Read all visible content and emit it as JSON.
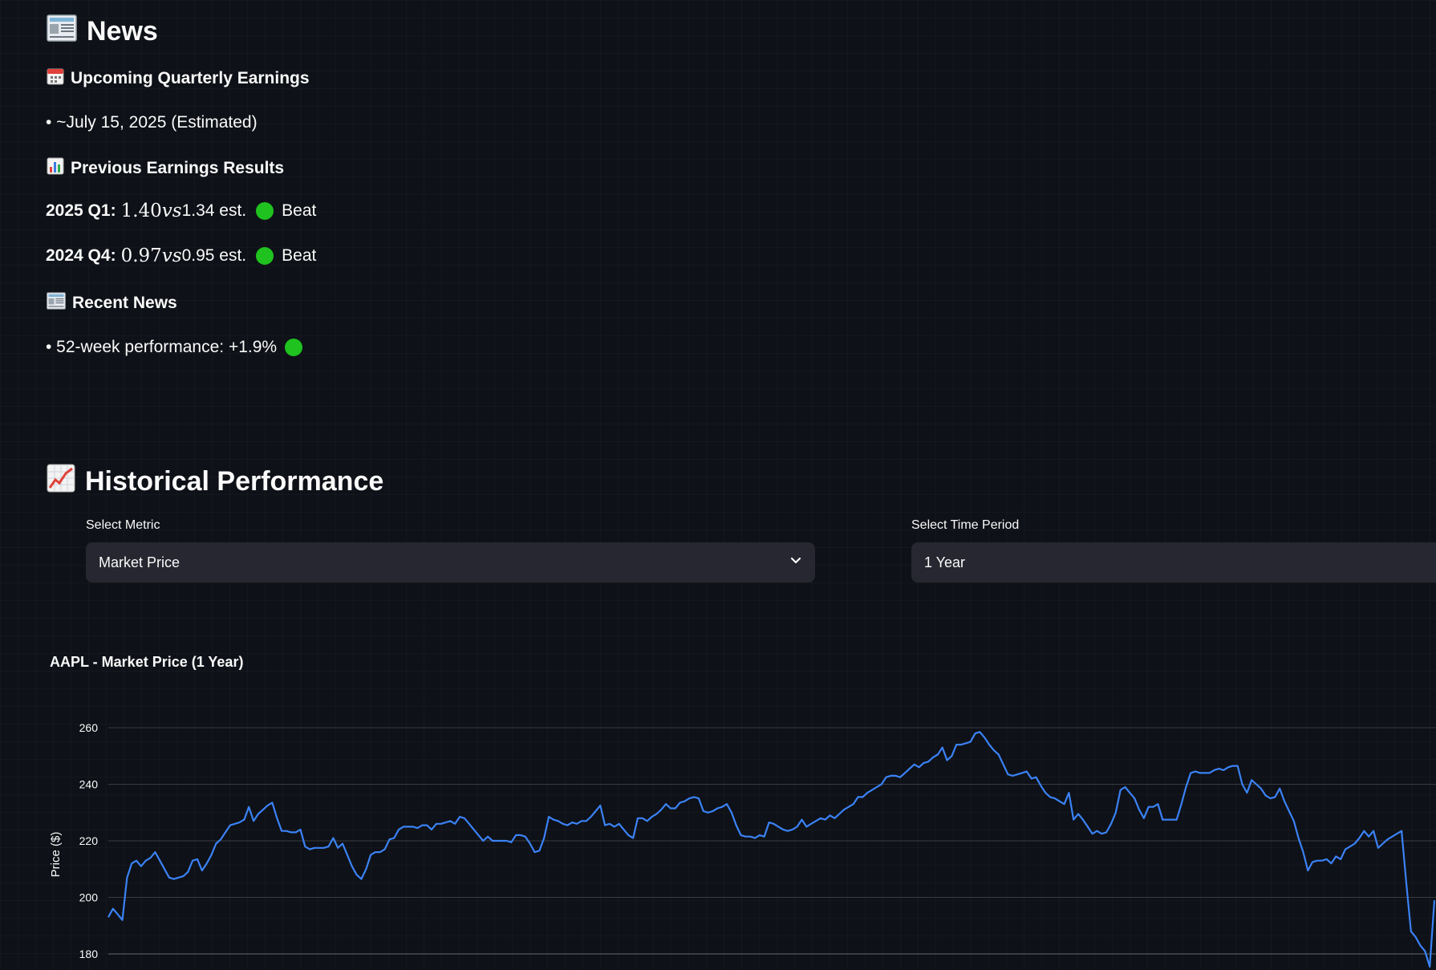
{
  "news": {
    "title": "News",
    "title_icon": "newspaper-icon",
    "upcoming": {
      "heading": "Upcoming Quarterly Earnings",
      "heading_icon": "calendar-icon",
      "item": "• ~July 15, 2025 (Estimated)"
    },
    "previous": {
      "heading": "Previous Earnings Results",
      "heading_icon": "bar-chart-icon",
      "results": [
        {
          "label": "2025 Q1:",
          "actual": "1.40",
          "vs": "vs",
          "est": "1.34 est.",
          "status": "Beat"
        },
        {
          "label": "2024 Q4:",
          "actual": "0.97",
          "vs": "vs",
          "est": "0.95 est.",
          "status": "Beat"
        }
      ]
    },
    "recent": {
      "heading": "Recent News",
      "heading_icon": "newspaper-icon",
      "item": "• 52-week performance: +1.9%"
    }
  },
  "historical": {
    "title": "Historical Performance",
    "title_icon": "chart-increasing-icon",
    "metric_label": "Select Metric",
    "metric_value": "Market Price",
    "period_label": "Select Time Period",
    "period_value": "1 Year"
  },
  "colors": {
    "background": "#0e1117",
    "select_bg": "#262730",
    "line": "#3b82f6",
    "status_green": "#1fc21f"
  },
  "chart_data": {
    "type": "line",
    "title": "AAPL - Market Price (1 Year)",
    "ylabel": "Price ($)",
    "ylim": [
      174,
      266
    ],
    "yticks": [
      180,
      200,
      220,
      240,
      260
    ],
    "grid": true,
    "series": [
      {
        "values": [
          193,
          196,
          194,
          192,
          207,
          212,
          213,
          211,
          213,
          214,
          216,
          213,
          210,
          207,
          206.5,
          207,
          207.5,
          209,
          213,
          213.5,
          209.5,
          212,
          215,
          219,
          220.5,
          223,
          225.5,
          226,
          226.5,
          227.5,
          232,
          227,
          229.5,
          231,
          232.5,
          233.5,
          228,
          223.5,
          223.5,
          223,
          223,
          224,
          218,
          217,
          217.5,
          217.5,
          217.5,
          218,
          221,
          217.5,
          219,
          215,
          211,
          208,
          206.5,
          210,
          215,
          216,
          216,
          217,
          220.5,
          221,
          224,
          225,
          225,
          225,
          224.5,
          225.5,
          225.5,
          224,
          226,
          226,
          226.5,
          227,
          226,
          228.5,
          228,
          226,
          224,
          222,
          220,
          221.5,
          220,
          220,
          220,
          220,
          219.5,
          222,
          222,
          221.5,
          219,
          216,
          216.5,
          221,
          228.5,
          227.5,
          227,
          226,
          225.5,
          226.5,
          226,
          227,
          227,
          228.5,
          230.5,
          232.5,
          225.5,
          226,
          225,
          226,
          224,
          222,
          221,
          228,
          228,
          227,
          228.5,
          229.5,
          231,
          233,
          231.5,
          231.5,
          233.5,
          234,
          235,
          235.5,
          235,
          230.5,
          230,
          230.5,
          231.5,
          232,
          233,
          230,
          225.5,
          222,
          221.5,
          221.5,
          221,
          222,
          221.5,
          226.5,
          226,
          225,
          224,
          223.5,
          224,
          225,
          227.5,
          225,
          226,
          227,
          228,
          227.5,
          229,
          228,
          229.5,
          231,
          232,
          233,
          235.5,
          235.5,
          237,
          238,
          239,
          240,
          242.5,
          243,
          243,
          242.5,
          244,
          245.5,
          247,
          246,
          247.5,
          248,
          249.5,
          250.5,
          253,
          248.5,
          250,
          254,
          254,
          254.5,
          255,
          258,
          258.5,
          256.5,
          254,
          252,
          250.5,
          247,
          243.5,
          243,
          243.5,
          244,
          244.5,
          242,
          242.5,
          239.5,
          237,
          235.5,
          235,
          234,
          233,
          237,
          227.5,
          229.5,
          227.5,
          225,
          222.5,
          223.5,
          222.5,
          223,
          226,
          230,
          238,
          239,
          237,
          235,
          231,
          228,
          232,
          232,
          233,
          227.5,
          227.5,
          227.5,
          227.5,
          233,
          239,
          244,
          244.5,
          244,
          244,
          244,
          245,
          245.5,
          245,
          246,
          246.5,
          246.5,
          240,
          237,
          241.5,
          240,
          238.5,
          236,
          235,
          235.5,
          238.5,
          234,
          230.5,
          227,
          221,
          216,
          209.5,
          212.5,
          213,
          213,
          213.5,
          212,
          214.5,
          213.5,
          217,
          218,
          219,
          221,
          223.5,
          221.5,
          223.5,
          217.5,
          219,
          220.5,
          221.5,
          222.5,
          223.5,
          205,
          188,
          186,
          183,
          181,
          175.5,
          199
        ]
      }
    ]
  }
}
